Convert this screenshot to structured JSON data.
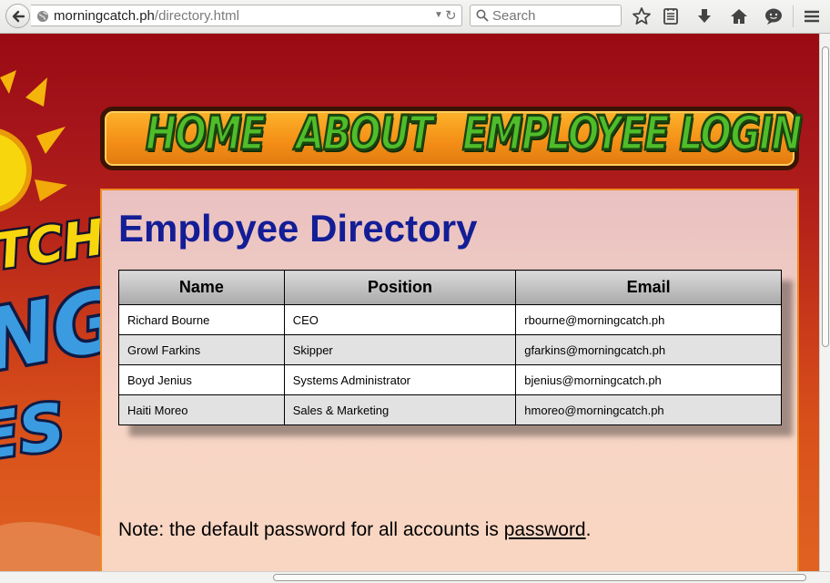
{
  "browser": {
    "url_host": "morningcatch.ph",
    "url_path": "/directory.html",
    "search_placeholder": "Search"
  },
  "nav": {
    "items": [
      {
        "label": "HOME"
      },
      {
        "label": "ABOUT"
      },
      {
        "label": "EMPLOYEE LOGIN"
      }
    ]
  },
  "main": {
    "title": "Employee Directory",
    "table": {
      "headers": [
        "Name",
        "Position",
        "Email"
      ],
      "rows": [
        [
          "Richard Bourne",
          "CEO",
          "rbourne@morningcatch.ph"
        ],
        [
          "Growl Farkins",
          "Skipper",
          "gfarkins@morningcatch.ph"
        ],
        [
          "Boyd Jenius",
          "Systems Administrator",
          "bjenius@morningcatch.ph"
        ],
        [
          "Haiti Moreo",
          "Sales & Marketing",
          "hmoreo@morningcatch.ph"
        ]
      ]
    },
    "note_prefix": "Note: the default password for all accounts is ",
    "note_link": "password",
    "note_suffix": "."
  },
  "logo": {
    "text_line1": "TCH",
    "text_line2": "NG",
    "text_line3": "ES"
  },
  "colors": {
    "title": "#131d96",
    "nav_text": "#4fbd2a",
    "nav_bar": "#f38d16",
    "content_border": "#ee8a22"
  },
  "icons": [
    "back-arrow-icon",
    "globe-icon",
    "dropdown-arrow-icon",
    "reload-icon",
    "search-icon",
    "bookmark-star-icon",
    "reading-list-icon",
    "download-icon",
    "home-icon",
    "chat-icon",
    "hamburger-menu-icon"
  ]
}
